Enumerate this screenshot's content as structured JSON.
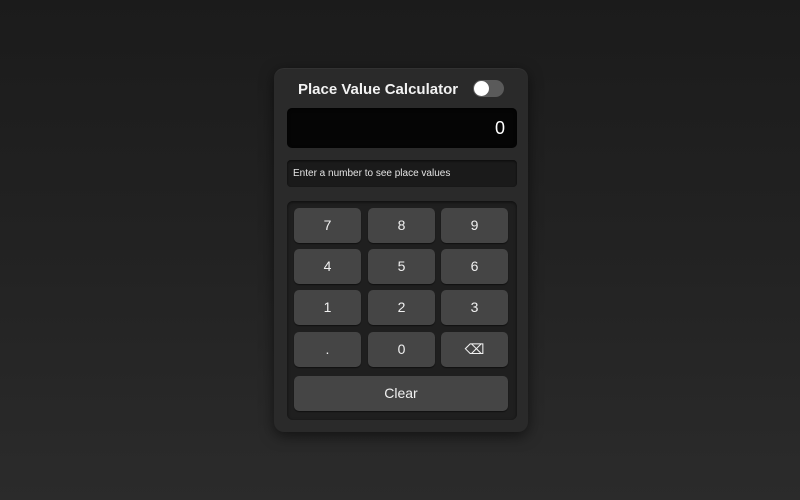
{
  "app": {
    "title": "Place Value Calculator"
  },
  "theme_toggle": {
    "state": "off",
    "track_color": "#5a5a5a",
    "knob_color": "#ffffff"
  },
  "display": {
    "value": "0"
  },
  "info": {
    "text": "Enter a number to see place values"
  },
  "keypad": {
    "keys": [
      "7",
      "8",
      "9",
      "4",
      "5",
      "6",
      "1",
      "2",
      "3",
      ".",
      "0",
      "⌫"
    ],
    "backspace_icon": "backspace-icon",
    "clear_label": "Clear"
  },
  "colors": {
    "background": "#222222",
    "panel": "#2a2a2a",
    "key": "#454545",
    "display": "#050505",
    "text": "#f2f2f2"
  }
}
